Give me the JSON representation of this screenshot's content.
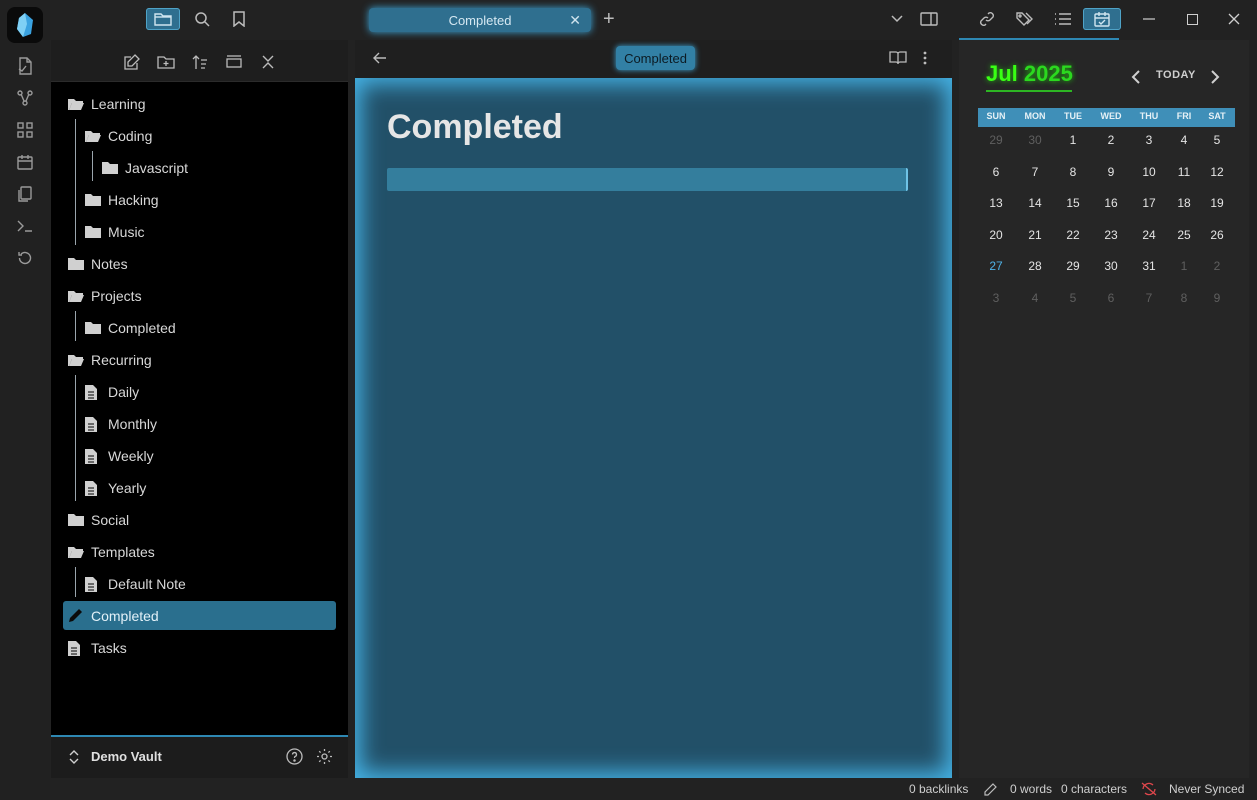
{
  "titlebar": {
    "tab_label": "Completed",
    "tab_close": "✕",
    "new_tab": "+"
  },
  "sidebar": {
    "tree": [
      {
        "label": "Learning",
        "icon": "folder-open-icon"
      },
      {
        "label": "Coding",
        "icon": "folder-open-icon"
      },
      {
        "label": "Javascript",
        "icon": "folder-icon"
      },
      {
        "label": "Hacking",
        "icon": "folder-icon"
      },
      {
        "label": "Music",
        "icon": "folder-icon"
      },
      {
        "label": "Notes",
        "icon": "folder-icon"
      },
      {
        "label": "Projects",
        "icon": "folder-open-icon"
      },
      {
        "label": "Completed",
        "icon": "folder-icon"
      },
      {
        "label": "Recurring",
        "icon": "folder-open-icon"
      },
      {
        "label": "Daily",
        "icon": "file-icon"
      },
      {
        "label": "Monthly",
        "icon": "file-icon"
      },
      {
        "label": "Weekly",
        "icon": "file-icon"
      },
      {
        "label": "Yearly",
        "icon": "file-icon"
      },
      {
        "label": "Social",
        "icon": "folder-icon"
      },
      {
        "label": "Templates",
        "icon": "folder-open-icon"
      },
      {
        "label": "Default Note",
        "icon": "file-icon"
      },
      {
        "label": "Completed",
        "icon": "pencil-icon"
      },
      {
        "label": "Tasks",
        "icon": "file-icon"
      }
    ],
    "vault_name": "Demo Vault"
  },
  "editor": {
    "header_title": "Completed",
    "note_title": "Completed"
  },
  "calendar": {
    "month": "Jul",
    "year": "2025",
    "today_label": "TODAY",
    "weekdays": [
      "SUN",
      "MON",
      "TUE",
      "WED",
      "THU",
      "FRI",
      "SAT"
    ],
    "weeks": [
      [
        "29",
        "30",
        "1",
        "2",
        "3",
        "4",
        "5"
      ],
      [
        "6",
        "7",
        "8",
        "9",
        "10",
        "11",
        "12"
      ],
      [
        "13",
        "14",
        "15",
        "16",
        "17",
        "18",
        "19"
      ],
      [
        "20",
        "21",
        "22",
        "23",
        "24",
        "25",
        "26"
      ],
      [
        "27",
        "28",
        "29",
        "30",
        "31",
        "1",
        "2"
      ],
      [
        "3",
        "4",
        "5",
        "6",
        "7",
        "8",
        "9"
      ]
    ],
    "today_date": "27",
    "accent_color": "#39ff14"
  },
  "statusbar": {
    "backlinks": "0 backlinks",
    "words": "0 words",
    "characters": "0 characters",
    "sync": "Never Synced"
  },
  "colors": {
    "accent": "#3ea6d8",
    "selection": "#2a6f8e",
    "editor_bg": "#225068"
  }
}
